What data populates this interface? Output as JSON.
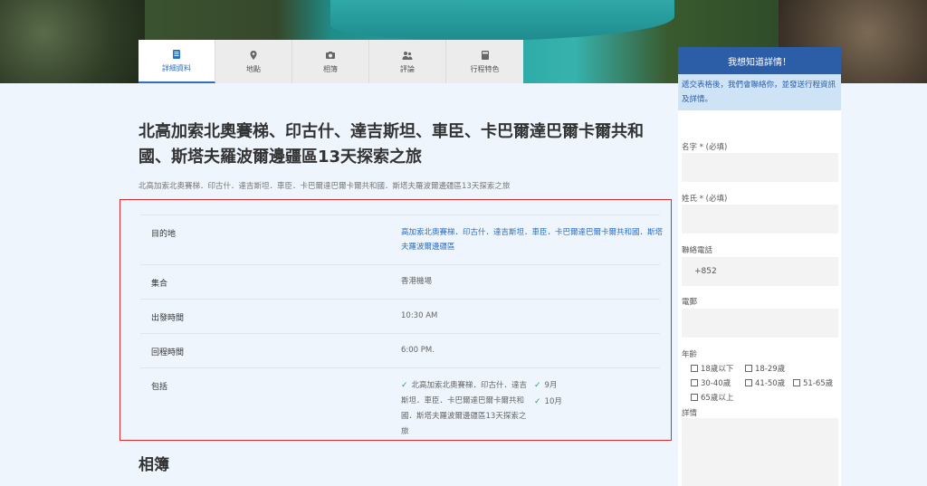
{
  "tabs": [
    {
      "label": "詳細資料",
      "icon": "document-icon",
      "active": true
    },
    {
      "label": "地點",
      "icon": "map-pin-icon",
      "active": false
    },
    {
      "label": "相簿",
      "icon": "camera-icon",
      "active": false
    },
    {
      "label": "評論",
      "icon": "users-icon",
      "active": false
    },
    {
      "label": "行程特色",
      "icon": "book-icon",
      "active": false
    }
  ],
  "title": "北高加索北奧賽梯、印古什、達吉斯坦、車臣、卡巴爾達巴爾卡爾共和國、斯塔夫羅波爾邊疆區13天探索之旅",
  "subtitle": "北高加索北奧賽梯．印古什．達吉斯坦．車臣．卡巴爾達巴爾卡爾共和國．斯塔夫羅波爾邊疆區13天探索之旅",
  "details": {
    "destination_label": "目的地",
    "destination_value": "高加索北奧賽梯．印古什．達吉斯坦．車臣．卡巴爾達巴爾卡爾共和國．斯塔夫羅波爾邊疆區",
    "meeting_label": "集合",
    "meeting_value": "香港機場",
    "departure_label": "出發時間",
    "departure_value": "10:30 AM",
    "return_label": "回程時間",
    "return_value": "6:00 PM.",
    "includes_label": "包括",
    "includes_main": "北高加索北奧賽梯．印古什．達吉斯坦．車臣．卡巴爾達巴爾卡爾共和國．斯塔夫羅波爾邊疆區13天探索之旅",
    "includes_months": [
      "9月",
      "10月"
    ]
  },
  "section_title": "相簿",
  "sidebar": {
    "header": "我想知道詳情！",
    "note": "遞交表格後，我們會聯絡你，並發送行程資訊及詳情。",
    "first_name_label": "名字 * (必填)",
    "last_name_label": "姓氏 * (必填)",
    "phone_label": "聯絡電話",
    "phone_value": "+852",
    "email_label": "電郵",
    "age_label": "年齡",
    "age_options": [
      "18歲以下",
      "18-29歲",
      "30-40歲",
      "41-50歲",
      "51-65歲",
      "65歲以上"
    ],
    "details_label": "詳情"
  },
  "colors": {
    "accent": "#2c5ea8",
    "highlight_border": "#d92c2c",
    "check": "#2aa76b"
  }
}
